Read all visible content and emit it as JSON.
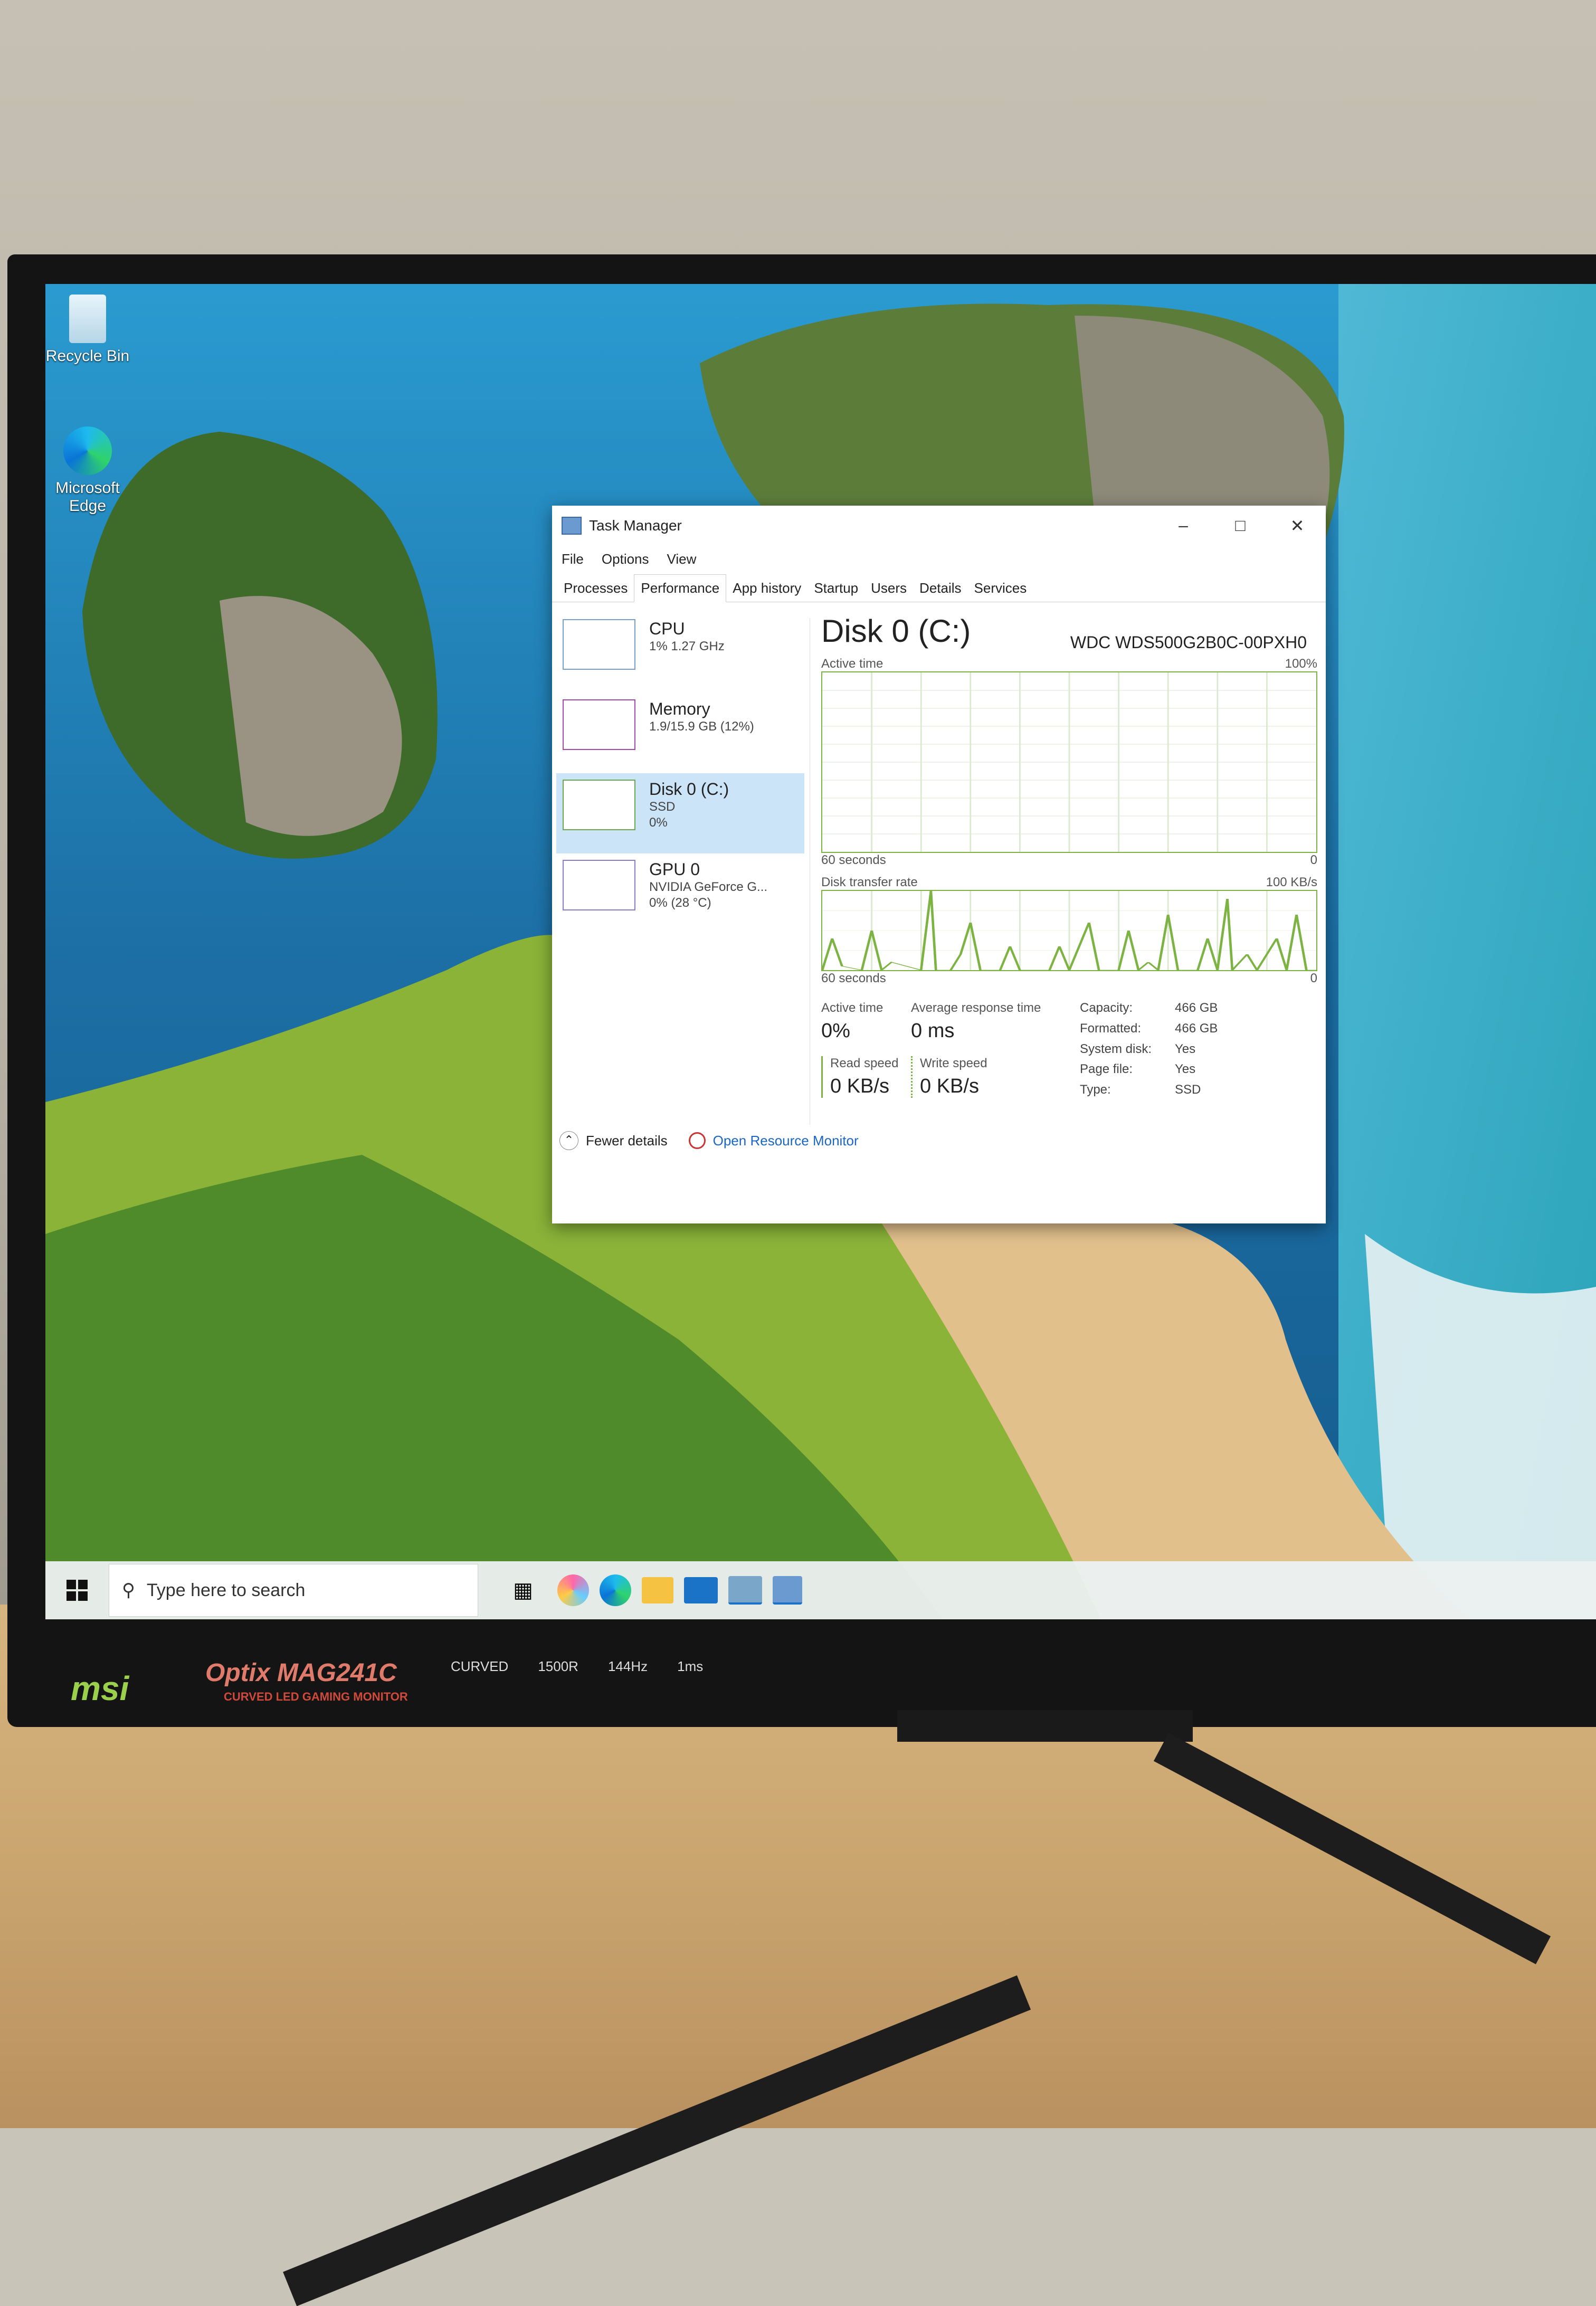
{
  "desktop": {
    "icons": [
      {
        "label": "Recycle Bin"
      },
      {
        "label": "Microsoft Edge"
      }
    ]
  },
  "task_manager": {
    "title": "Task Manager",
    "menu": [
      "File",
      "Options",
      "View"
    ],
    "tabs": [
      "Processes",
      "Performance",
      "App history",
      "Startup",
      "Users",
      "Details",
      "Services"
    ],
    "active_tab": "Performance",
    "left_items": [
      {
        "name": "CPU",
        "line1": "1% 1.27 GHz",
        "line2": ""
      },
      {
        "name": "Memory",
        "line1": "1.9/15.9 GB (12%)",
        "line2": ""
      },
      {
        "name": "Disk 0 (C:)",
        "line1": "SSD",
        "line2": "0%"
      },
      {
        "name": "GPU 0",
        "line1": "NVIDIA GeForce G...",
        "line2": "0% (28 °C)"
      }
    ],
    "disk": {
      "title": "Disk 0 (C:)",
      "model": "WDC WDS500G2B0C-00PXH0",
      "active_chart": {
        "label": "Active time",
        "max": "100%",
        "xlabel": "60 seconds",
        "min": "0"
      },
      "transfer_chart": {
        "label": "Disk transfer rate",
        "max": "100 KB/s",
        "xlabel": "60 seconds",
        "min": "0"
      },
      "active_time_label": "Active time",
      "active_time": "0%",
      "avg_resp_label": "Average response time",
      "avg_resp": "0 ms",
      "read_label": "Read speed",
      "read": "0 KB/s",
      "write_label": "Write speed",
      "write": "0 KB/s",
      "props": [
        {
          "k": "Capacity:",
          "v": "466 GB"
        },
        {
          "k": "Formatted:",
          "v": "466 GB"
        },
        {
          "k": "System disk:",
          "v": "Yes"
        },
        {
          "k": "Page file:",
          "v": "Yes"
        },
        {
          "k": "Type:",
          "v": "SSD"
        }
      ]
    },
    "footer": {
      "fewer": "Fewer details",
      "resmon": "Open Resource Monitor"
    }
  },
  "taskbar": {
    "search_placeholder": "Type here to search"
  },
  "monitor": {
    "brand": "msi",
    "model": "Optix MAG241C",
    "subtitle": "CURVED LED GAMING MONITOR",
    "features": [
      "CURVED",
      "1500R",
      "144Hz",
      "1ms"
    ]
  },
  "colors": {
    "disk_green": "#7cb342",
    "selected_bg": "#cce4f7",
    "link": "#1a66c2"
  }
}
